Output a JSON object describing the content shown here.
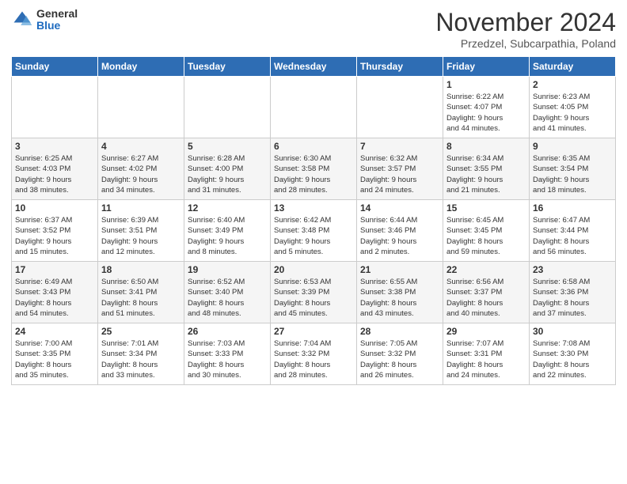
{
  "logo": {
    "general": "General",
    "blue": "Blue"
  },
  "title": "November 2024",
  "subtitle": "Przedzel, Subcarpathia, Poland",
  "headers": [
    "Sunday",
    "Monday",
    "Tuesday",
    "Wednesday",
    "Thursday",
    "Friday",
    "Saturday"
  ],
  "weeks": [
    [
      {
        "day": "",
        "info": ""
      },
      {
        "day": "",
        "info": ""
      },
      {
        "day": "",
        "info": ""
      },
      {
        "day": "",
        "info": ""
      },
      {
        "day": "",
        "info": ""
      },
      {
        "day": "1",
        "info": "Sunrise: 6:22 AM\nSunset: 4:07 PM\nDaylight: 9 hours\nand 44 minutes."
      },
      {
        "day": "2",
        "info": "Sunrise: 6:23 AM\nSunset: 4:05 PM\nDaylight: 9 hours\nand 41 minutes."
      }
    ],
    [
      {
        "day": "3",
        "info": "Sunrise: 6:25 AM\nSunset: 4:03 PM\nDaylight: 9 hours\nand 38 minutes."
      },
      {
        "day": "4",
        "info": "Sunrise: 6:27 AM\nSunset: 4:02 PM\nDaylight: 9 hours\nand 34 minutes."
      },
      {
        "day": "5",
        "info": "Sunrise: 6:28 AM\nSunset: 4:00 PM\nDaylight: 9 hours\nand 31 minutes."
      },
      {
        "day": "6",
        "info": "Sunrise: 6:30 AM\nSunset: 3:58 PM\nDaylight: 9 hours\nand 28 minutes."
      },
      {
        "day": "7",
        "info": "Sunrise: 6:32 AM\nSunset: 3:57 PM\nDaylight: 9 hours\nand 24 minutes."
      },
      {
        "day": "8",
        "info": "Sunrise: 6:34 AM\nSunset: 3:55 PM\nDaylight: 9 hours\nand 21 minutes."
      },
      {
        "day": "9",
        "info": "Sunrise: 6:35 AM\nSunset: 3:54 PM\nDaylight: 9 hours\nand 18 minutes."
      }
    ],
    [
      {
        "day": "10",
        "info": "Sunrise: 6:37 AM\nSunset: 3:52 PM\nDaylight: 9 hours\nand 15 minutes."
      },
      {
        "day": "11",
        "info": "Sunrise: 6:39 AM\nSunset: 3:51 PM\nDaylight: 9 hours\nand 12 minutes."
      },
      {
        "day": "12",
        "info": "Sunrise: 6:40 AM\nSunset: 3:49 PM\nDaylight: 9 hours\nand 8 minutes."
      },
      {
        "day": "13",
        "info": "Sunrise: 6:42 AM\nSunset: 3:48 PM\nDaylight: 9 hours\nand 5 minutes."
      },
      {
        "day": "14",
        "info": "Sunrise: 6:44 AM\nSunset: 3:46 PM\nDaylight: 9 hours\nand 2 minutes."
      },
      {
        "day": "15",
        "info": "Sunrise: 6:45 AM\nSunset: 3:45 PM\nDaylight: 8 hours\nand 59 minutes."
      },
      {
        "day": "16",
        "info": "Sunrise: 6:47 AM\nSunset: 3:44 PM\nDaylight: 8 hours\nand 56 minutes."
      }
    ],
    [
      {
        "day": "17",
        "info": "Sunrise: 6:49 AM\nSunset: 3:43 PM\nDaylight: 8 hours\nand 54 minutes."
      },
      {
        "day": "18",
        "info": "Sunrise: 6:50 AM\nSunset: 3:41 PM\nDaylight: 8 hours\nand 51 minutes."
      },
      {
        "day": "19",
        "info": "Sunrise: 6:52 AM\nSunset: 3:40 PM\nDaylight: 8 hours\nand 48 minutes."
      },
      {
        "day": "20",
        "info": "Sunrise: 6:53 AM\nSunset: 3:39 PM\nDaylight: 8 hours\nand 45 minutes."
      },
      {
        "day": "21",
        "info": "Sunrise: 6:55 AM\nSunset: 3:38 PM\nDaylight: 8 hours\nand 43 minutes."
      },
      {
        "day": "22",
        "info": "Sunrise: 6:56 AM\nSunset: 3:37 PM\nDaylight: 8 hours\nand 40 minutes."
      },
      {
        "day": "23",
        "info": "Sunrise: 6:58 AM\nSunset: 3:36 PM\nDaylight: 8 hours\nand 37 minutes."
      }
    ],
    [
      {
        "day": "24",
        "info": "Sunrise: 7:00 AM\nSunset: 3:35 PM\nDaylight: 8 hours\nand 35 minutes."
      },
      {
        "day": "25",
        "info": "Sunrise: 7:01 AM\nSunset: 3:34 PM\nDaylight: 8 hours\nand 33 minutes."
      },
      {
        "day": "26",
        "info": "Sunrise: 7:03 AM\nSunset: 3:33 PM\nDaylight: 8 hours\nand 30 minutes."
      },
      {
        "day": "27",
        "info": "Sunrise: 7:04 AM\nSunset: 3:32 PM\nDaylight: 8 hours\nand 28 minutes."
      },
      {
        "day": "28",
        "info": "Sunrise: 7:05 AM\nSunset: 3:32 PM\nDaylight: 8 hours\nand 26 minutes."
      },
      {
        "day": "29",
        "info": "Sunrise: 7:07 AM\nSunset: 3:31 PM\nDaylight: 8 hours\nand 24 minutes."
      },
      {
        "day": "30",
        "info": "Sunrise: 7:08 AM\nSunset: 3:30 PM\nDaylight: 8 hours\nand 22 minutes."
      }
    ]
  ]
}
